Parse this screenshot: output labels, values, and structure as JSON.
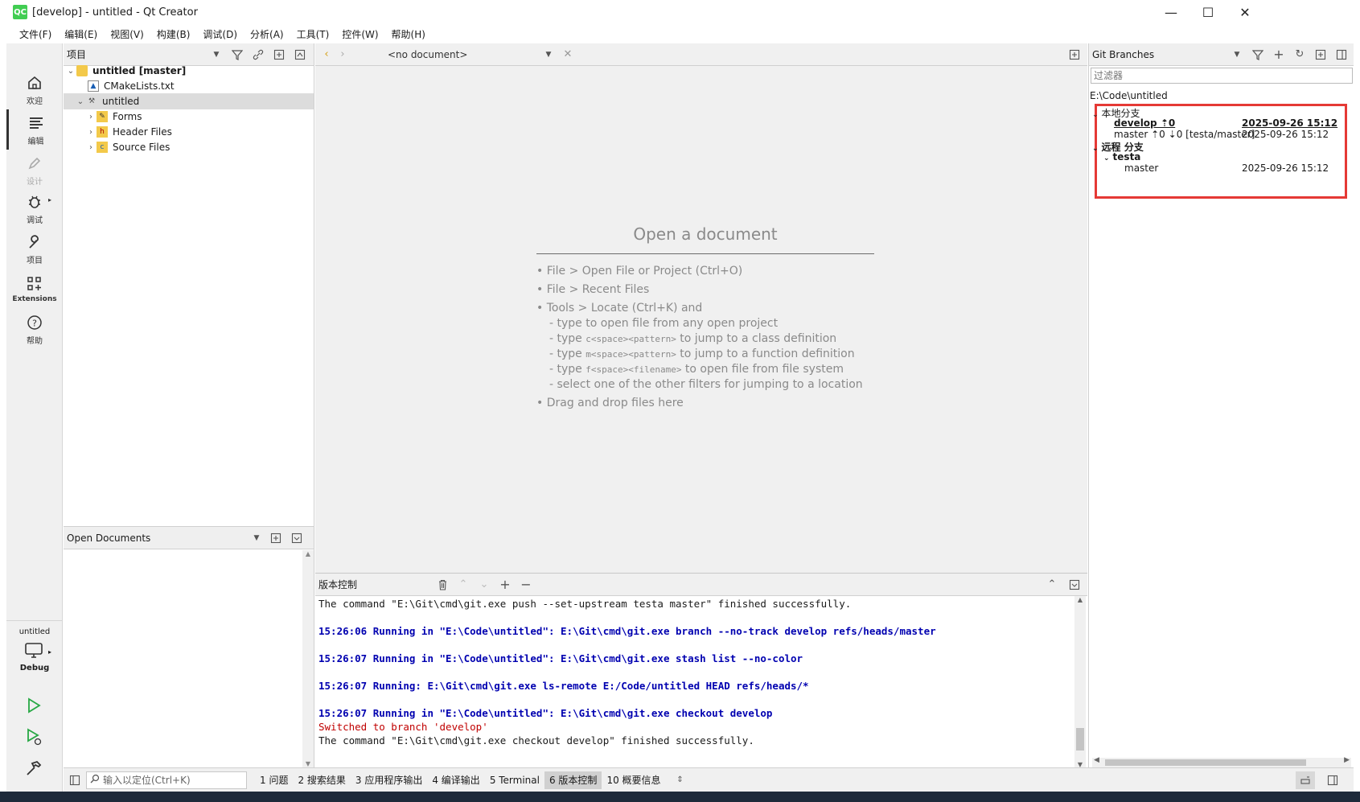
{
  "window": {
    "title": "[develop] - untitled - Qt Creator",
    "app_icon": "QC",
    "minimize": "—",
    "maximize": "☐",
    "close": "✕"
  },
  "menu": [
    "文件(F)",
    "编辑(E)",
    "视图(V)",
    "构建(B)",
    "调试(D)",
    "分析(A)",
    "工具(T)",
    "控件(W)",
    "帮助(H)"
  ],
  "modes": {
    "welcome": "欢迎",
    "edit": "编辑",
    "design": "设计",
    "debug": "调试",
    "projects": "项目",
    "extensions": "Extensions",
    "help": "帮助"
  },
  "kit": {
    "project": "untitled",
    "config": "Debug"
  },
  "project_panel": {
    "title": "项目",
    "tree": [
      {
        "label": "untitled [master]",
        "bold": true
      },
      {
        "label": "CMakeLists.txt"
      },
      {
        "label": "untitled"
      },
      {
        "label": "Forms"
      },
      {
        "label": "Header Files"
      },
      {
        "label": "Source Files"
      }
    ]
  },
  "open_documents": {
    "title": "Open Documents"
  },
  "editor": {
    "doc_selector": "<no document>",
    "welcome_title": "Open a document",
    "lines": {
      "l1": "• File > Open File or Project (Ctrl+O)",
      "l2": "• File > Recent Files",
      "l3": "• Tools > Locate (Ctrl+K) and",
      "s1": "- type to open file from any open project",
      "s2a": "- type ",
      "s2m": "c<space><pattern>",
      "s2b": " to jump to a class definition",
      "s3a": "- type ",
      "s3m": "m<space><pattern>",
      "s3b": " to jump to a function definition",
      "s4a": "- type ",
      "s4m": "f<space><filename>",
      "s4b": " to open file from file system",
      "s5": "- select one of the other filters for jumping to a location",
      "l4": "• Drag and drop files here"
    }
  },
  "vc_panel": {
    "title": "版本控制",
    "log": [
      {
        "text": "The command \"E:\\Git\\cmd\\git.exe push --set-upstream testa master\" finished successfully.",
        "style": "normal"
      },
      {
        "text": "15:26:06 Running in \"E:\\Code\\untitled\": E:\\Git\\cmd\\git.exe branch --no-track develop refs/heads/master",
        "style": "blue"
      },
      {
        "text": "15:26:07 Running in \"E:\\Code\\untitled\": E:\\Git\\cmd\\git.exe stash list --no-color",
        "style": "blue"
      },
      {
        "text": "15:26:07 Running: E:\\Git\\cmd\\git.exe ls-remote E:/Code/untitled HEAD refs/heads/*",
        "style": "blue"
      },
      {
        "text": "15:26:07 Running in \"E:\\Code\\untitled\": E:\\Git\\cmd\\git.exe checkout develop",
        "style": "blue"
      },
      {
        "text": "Switched to branch 'develop'",
        "style": "red"
      },
      {
        "text": "The command \"E:\\Git\\cmd\\git.exe checkout develop\" finished successfully.",
        "style": "normal"
      }
    ]
  },
  "git_branches": {
    "title": "Git Branches",
    "filter_placeholder": "过滤器",
    "repo_path": "E:\\Code\\untitled",
    "local_header": "本地分支",
    "local": [
      {
        "name": "develop ⇡0",
        "date": "2025-09-26 15:12",
        "current": true
      },
      {
        "name": "master ⇡0 ⇣0 [testa/master]",
        "date": "2025-09-26 15:12",
        "current": false
      }
    ],
    "remote_header": "远程 分支",
    "remote_name": "testa",
    "remote": [
      {
        "name": "master",
        "date": "2025-09-26 15:12"
      }
    ]
  },
  "status_bar": {
    "locator_placeholder": "输入以定位(Ctrl+K)",
    "tabs": [
      "1 问题",
      "2 搜索结果",
      "3 应用程序输出",
      "4 编译输出",
      "5 Terminal",
      "6 版本控制",
      "10 概要信息"
    ],
    "active_tab": 5
  }
}
